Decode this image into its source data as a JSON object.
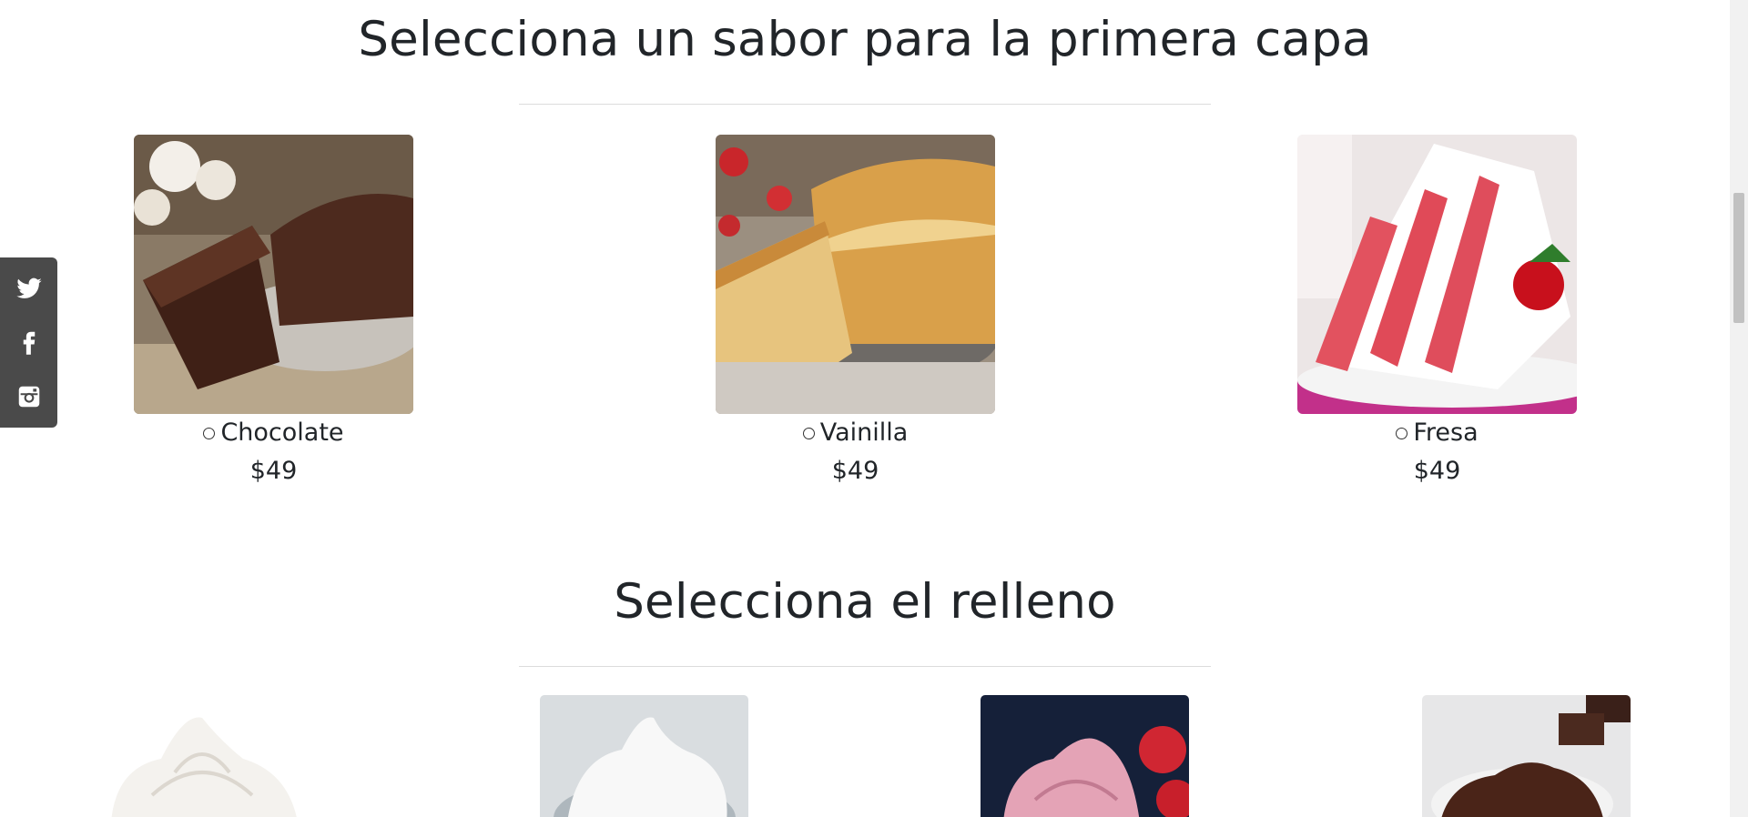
{
  "sections": {
    "first_layer_title": "Selecciona un sabor para la primera capa",
    "filling_title": "Selecciona el relleno"
  },
  "flavors": [
    {
      "name": "Chocolate",
      "price": "$49",
      "image": "chocolate-cake-image"
    },
    {
      "name": "Vainilla",
      "price": "$49",
      "image": "vanilla-cake-image"
    },
    {
      "name": "Fresa",
      "price": "$49",
      "image": "strawberry-cake-image"
    }
  ],
  "fillings": [
    {
      "image": "whipped-cream-image"
    },
    {
      "image": "meringue-bowl-image"
    },
    {
      "image": "strawberry-frosting-image"
    },
    {
      "image": "chocolate-frosting-image"
    }
  ],
  "social": [
    "twitter-icon",
    "facebook-icon",
    "instagram-icon"
  ],
  "colors": {
    "sidebar_bg": "#4a4a4a",
    "text": "#212529"
  }
}
